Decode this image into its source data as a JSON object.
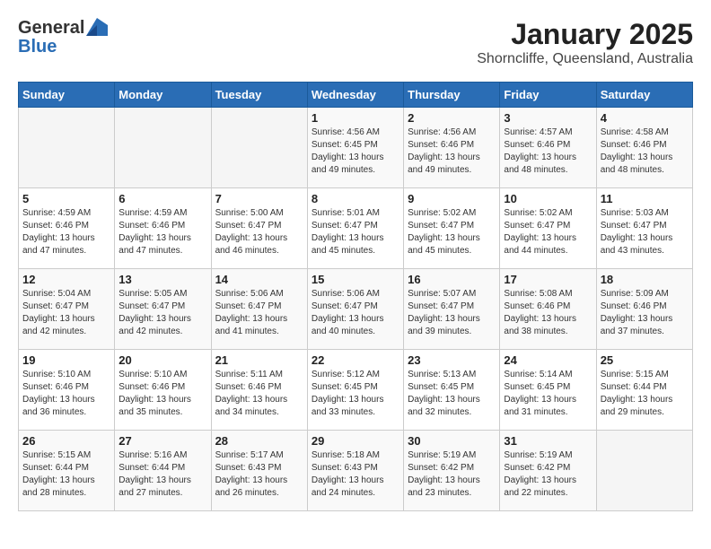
{
  "header": {
    "logo_general": "General",
    "logo_blue": "Blue",
    "title": "January 2025",
    "location": "Shorncliffe, Queensland, Australia"
  },
  "weekdays": [
    "Sunday",
    "Monday",
    "Tuesday",
    "Wednesday",
    "Thursday",
    "Friday",
    "Saturday"
  ],
  "weeks": [
    [
      {
        "day": "",
        "info": ""
      },
      {
        "day": "",
        "info": ""
      },
      {
        "day": "",
        "info": ""
      },
      {
        "day": "1",
        "info": "Sunrise: 4:56 AM\nSunset: 6:45 PM\nDaylight: 13 hours\nand 49 minutes."
      },
      {
        "day": "2",
        "info": "Sunrise: 4:56 AM\nSunset: 6:46 PM\nDaylight: 13 hours\nand 49 minutes."
      },
      {
        "day": "3",
        "info": "Sunrise: 4:57 AM\nSunset: 6:46 PM\nDaylight: 13 hours\nand 48 minutes."
      },
      {
        "day": "4",
        "info": "Sunrise: 4:58 AM\nSunset: 6:46 PM\nDaylight: 13 hours\nand 48 minutes."
      }
    ],
    [
      {
        "day": "5",
        "info": "Sunrise: 4:59 AM\nSunset: 6:46 PM\nDaylight: 13 hours\nand 47 minutes."
      },
      {
        "day": "6",
        "info": "Sunrise: 4:59 AM\nSunset: 6:46 PM\nDaylight: 13 hours\nand 47 minutes."
      },
      {
        "day": "7",
        "info": "Sunrise: 5:00 AM\nSunset: 6:47 PM\nDaylight: 13 hours\nand 46 minutes."
      },
      {
        "day": "8",
        "info": "Sunrise: 5:01 AM\nSunset: 6:47 PM\nDaylight: 13 hours\nand 45 minutes."
      },
      {
        "day": "9",
        "info": "Sunrise: 5:02 AM\nSunset: 6:47 PM\nDaylight: 13 hours\nand 45 minutes."
      },
      {
        "day": "10",
        "info": "Sunrise: 5:02 AM\nSunset: 6:47 PM\nDaylight: 13 hours\nand 44 minutes."
      },
      {
        "day": "11",
        "info": "Sunrise: 5:03 AM\nSunset: 6:47 PM\nDaylight: 13 hours\nand 43 minutes."
      }
    ],
    [
      {
        "day": "12",
        "info": "Sunrise: 5:04 AM\nSunset: 6:47 PM\nDaylight: 13 hours\nand 42 minutes."
      },
      {
        "day": "13",
        "info": "Sunrise: 5:05 AM\nSunset: 6:47 PM\nDaylight: 13 hours\nand 42 minutes."
      },
      {
        "day": "14",
        "info": "Sunrise: 5:06 AM\nSunset: 6:47 PM\nDaylight: 13 hours\nand 41 minutes."
      },
      {
        "day": "15",
        "info": "Sunrise: 5:06 AM\nSunset: 6:47 PM\nDaylight: 13 hours\nand 40 minutes."
      },
      {
        "day": "16",
        "info": "Sunrise: 5:07 AM\nSunset: 6:47 PM\nDaylight: 13 hours\nand 39 minutes."
      },
      {
        "day": "17",
        "info": "Sunrise: 5:08 AM\nSunset: 6:46 PM\nDaylight: 13 hours\nand 38 minutes."
      },
      {
        "day": "18",
        "info": "Sunrise: 5:09 AM\nSunset: 6:46 PM\nDaylight: 13 hours\nand 37 minutes."
      }
    ],
    [
      {
        "day": "19",
        "info": "Sunrise: 5:10 AM\nSunset: 6:46 PM\nDaylight: 13 hours\nand 36 minutes."
      },
      {
        "day": "20",
        "info": "Sunrise: 5:10 AM\nSunset: 6:46 PM\nDaylight: 13 hours\nand 35 minutes."
      },
      {
        "day": "21",
        "info": "Sunrise: 5:11 AM\nSunset: 6:46 PM\nDaylight: 13 hours\nand 34 minutes."
      },
      {
        "day": "22",
        "info": "Sunrise: 5:12 AM\nSunset: 6:45 PM\nDaylight: 13 hours\nand 33 minutes."
      },
      {
        "day": "23",
        "info": "Sunrise: 5:13 AM\nSunset: 6:45 PM\nDaylight: 13 hours\nand 32 minutes."
      },
      {
        "day": "24",
        "info": "Sunrise: 5:14 AM\nSunset: 6:45 PM\nDaylight: 13 hours\nand 31 minutes."
      },
      {
        "day": "25",
        "info": "Sunrise: 5:15 AM\nSunset: 6:44 PM\nDaylight: 13 hours\nand 29 minutes."
      }
    ],
    [
      {
        "day": "26",
        "info": "Sunrise: 5:15 AM\nSunset: 6:44 PM\nDaylight: 13 hours\nand 28 minutes."
      },
      {
        "day": "27",
        "info": "Sunrise: 5:16 AM\nSunset: 6:44 PM\nDaylight: 13 hours\nand 27 minutes."
      },
      {
        "day": "28",
        "info": "Sunrise: 5:17 AM\nSunset: 6:43 PM\nDaylight: 13 hours\nand 26 minutes."
      },
      {
        "day": "29",
        "info": "Sunrise: 5:18 AM\nSunset: 6:43 PM\nDaylight: 13 hours\nand 24 minutes."
      },
      {
        "day": "30",
        "info": "Sunrise: 5:19 AM\nSunset: 6:42 PM\nDaylight: 13 hours\nand 23 minutes."
      },
      {
        "day": "31",
        "info": "Sunrise: 5:19 AM\nSunset: 6:42 PM\nDaylight: 13 hours\nand 22 minutes."
      },
      {
        "day": "",
        "info": ""
      }
    ]
  ]
}
